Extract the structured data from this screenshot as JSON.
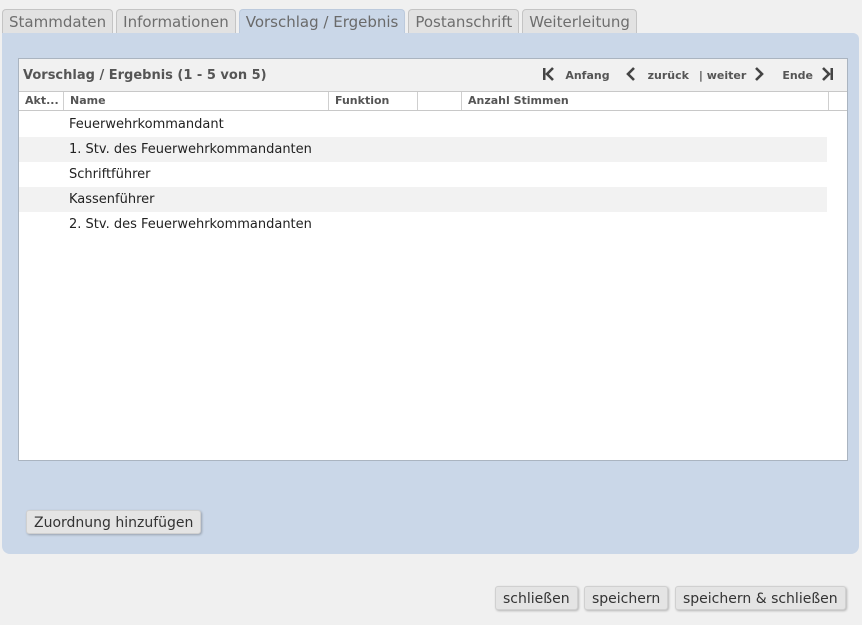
{
  "tabs": [
    {
      "label": "Stammdaten"
    },
    {
      "label": "Informationen"
    },
    {
      "label": "Vorschlag / Ergebnis"
    },
    {
      "label": "Postanschrift"
    },
    {
      "label": "Weiterleitung"
    }
  ],
  "grid": {
    "title": "Vorschlag / Ergebnis (1 - 5 von 5)",
    "pager": {
      "first": "Anfang",
      "prev": "zurück",
      "next": "| weiter",
      "last": "Ende"
    },
    "columns": [
      "Akt...",
      "Name",
      "Funktion",
      "",
      "Anzahl Stimmen"
    ],
    "rows": [
      {
        "name": "Feuerwehrkommandant"
      },
      {
        "name": "1. Stv. des Feuerwehrkommandanten"
      },
      {
        "name": "Schriftführer"
      },
      {
        "name": "Kassenführer"
      },
      {
        "name": "2. Stv. des Feuerwehrkommandanten"
      }
    ]
  },
  "actions": {
    "add_assignment": "Zuordnung hinzufügen",
    "close": "schließen",
    "save": "speichern",
    "save_close": "speichern & schließen"
  },
  "icons": {
    "first": "first-page-icon",
    "prev": "previous-page-icon",
    "next": "next-page-icon",
    "last": "last-page-icon"
  },
  "colors": {
    "panel": "#cad7e8",
    "background": "#f0f0f0"
  }
}
